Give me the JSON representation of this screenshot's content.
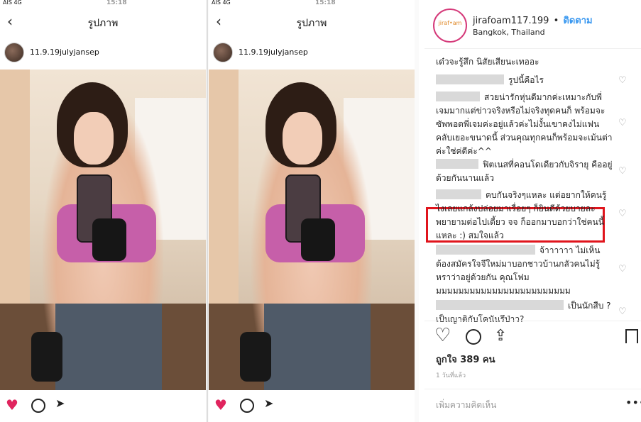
{
  "left": {
    "panels": [
      {
        "carrier": "AIS 4G",
        "time": "15:18",
        "title": "รูปภาพ",
        "username": "11.9.19julyjansep"
      },
      {
        "carrier": "AIS 4G",
        "time": "15:18",
        "title": "รูปภาพ",
        "username": "11.9.19julyjansep"
      }
    ]
  },
  "post": {
    "username": "jirafoam117.199",
    "separator": "•",
    "follow": "ติดตาม",
    "location": "Bangkok, Thailand",
    "logo_text": "jiraf•am"
  },
  "comments": [
    {
      "text": "เด๋วจะรู้สึก นิสัยเสียนะเทออะ",
      "show_blur": false
    },
    {
      "text": "รูปนี้คือไร",
      "show_blur": true
    },
    {
      "text": "สวยน่ารักหุ่นดีมากค่ะเหมาะกับพี่เจมมากแต่ข่าวจริงหรือไม่จริงทุดคนก็ พร้อมจะซัพพอตพี่เจมค่ะอยู่แล้วค่ะไม่งั้นเขาคงไม่แฟนคลับเยอะขนาดนี้ ส่วนคุณทุกคนก็พร้อมจะเม้นต่าค่ะใช่ค่ดีค่ะ^^",
      "show_blur": true
    },
    {
      "text": "ฟิตเนสที่คอนโดเดียวกับจิรายุ คืออยู่ด้วยกันนานแล้ว",
      "show_blur": true
    },
    {
      "text": "คบกันจริงๆแหละ แต่อยากให้คนรู้ไงเลยแกล้งปล่อยมาเรื่อยๆ ก็ยินดีด้วยบายละพยายามต่อไปเดี้ยว จจ ก็ออกมาบอกว่าใช่คนนี้แหละ :) สมใจแล้ว",
      "show_blur": true
    },
    {
      "text": "จ้าาาาาา ไม่เห็นต้องสมัครใจจึใหม่มาบอกชาวบ้านกลัวคนไม่รู้หราว่าอยู่ด้วยกัน คุณโฟม มมมมมมมมมมมมมมมมมมมมมมมม",
      "show_blur": true
    },
    {
      "text": "เป็นนักสืบ ? เป็นญาติกับโคนันรึป่าว?",
      "show_blur": true
    }
  ],
  "actions": {
    "likes": "ถูกใจ 389 คน",
    "time": "1 วันที่แล้ว",
    "add_comment": "เพิ่มความคิดเห็น",
    "more": "•••"
  },
  "colors": {
    "follow": "#3897f0",
    "highlight": "#e0141c",
    "like_red": "#e0245e"
  },
  "icons": [
    "back-icon",
    "heart-icon",
    "comment-icon",
    "share-icon",
    "bookmark-icon",
    "more-icon"
  ]
}
